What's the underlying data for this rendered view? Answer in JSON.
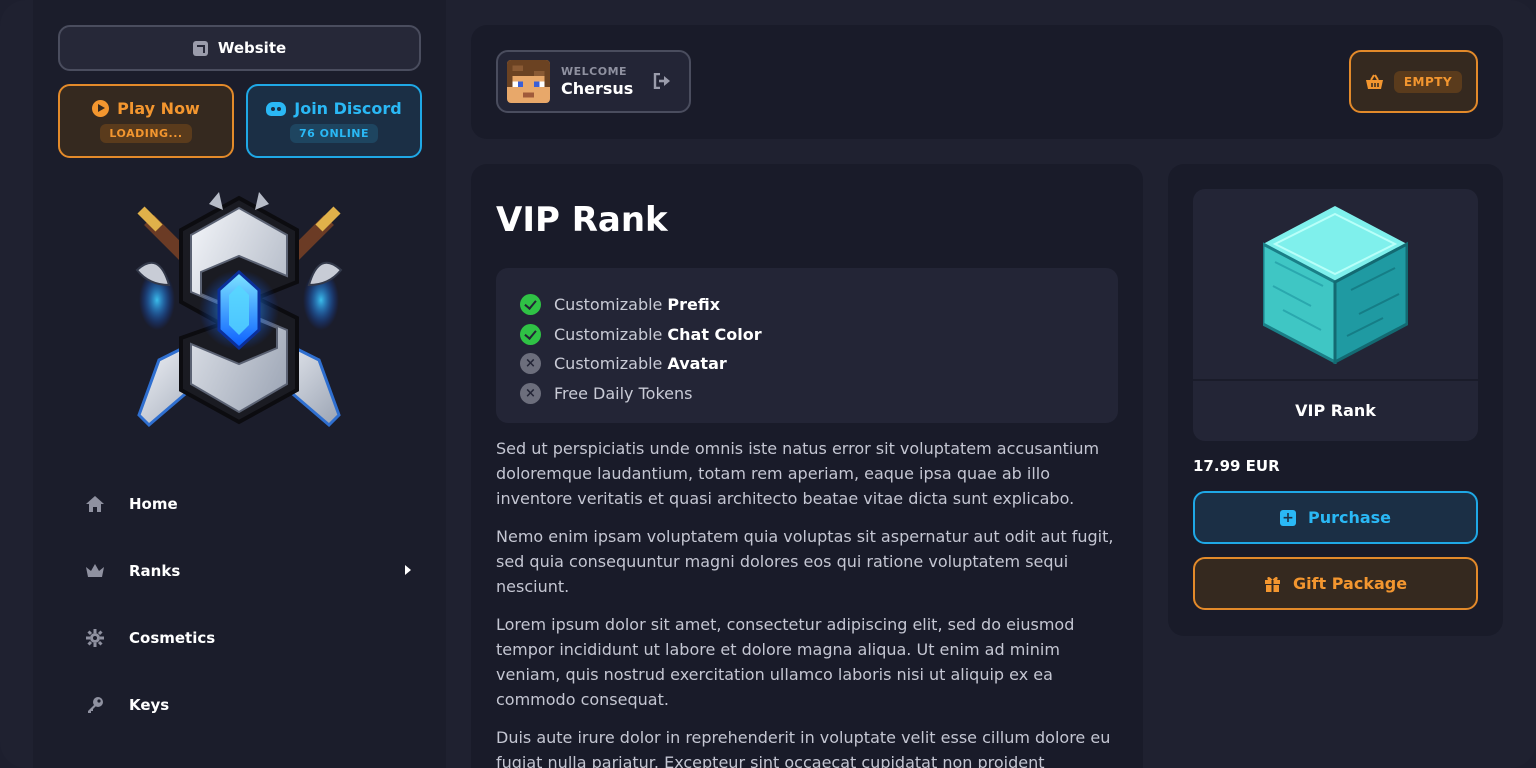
{
  "colors": {
    "accent_orange": "#f3962f",
    "accent_blue": "#2ab8f5",
    "check_green": "#2fc245",
    "background": "#1f2130"
  },
  "sidebar": {
    "website_label": "Website",
    "play": {
      "label": "Play Now",
      "status": "LOADING..."
    },
    "discord": {
      "label": "Join Discord",
      "status": "76 ONLINE"
    },
    "nav": [
      {
        "label": "Home",
        "icon": "home-icon"
      },
      {
        "label": "Ranks",
        "icon": "crown-icon",
        "has_submenu": true
      },
      {
        "label": "Cosmetics",
        "icon": "gear-icon"
      },
      {
        "label": "Keys",
        "icon": "key-icon"
      }
    ]
  },
  "header": {
    "welcome_label": "WELCOME",
    "username": "Chersus",
    "cart_status": "EMPTY"
  },
  "main": {
    "title": "VIP Rank",
    "features": [
      {
        "prefix": "Customizable",
        "bold": "Prefix",
        "included": true
      },
      {
        "prefix": "Customizable",
        "bold": "Chat Color",
        "included": true
      },
      {
        "prefix": "Customizable",
        "bold": "Avatar",
        "included": false
      },
      {
        "prefix": "Free Daily Tokens",
        "bold": "",
        "included": false
      }
    ],
    "paragraphs": [
      "Sed ut perspiciatis unde omnis iste natus error sit voluptatem accusantium doloremque laudantium, totam rem aperiam, eaque ipsa quae ab illo inventore veritatis et quasi architecto beatae vitae dicta sunt explicabo.",
      "Nemo enim ipsam voluptatem quia voluptas sit aspernatur aut odit aut fugit, sed quia consequuntur magni dolores eos qui ratione voluptatem sequi nesciunt.",
      "Lorem ipsum dolor sit amet, consectetur adipiscing elit, sed do eiusmod tempor incididunt ut labore et dolore magna aliqua. Ut enim ad minim veniam, quis nostrud exercitation ullamco laboris nisi ut aliquip ex ea commodo consequat.",
      "Duis aute irure dolor in reprehenderit in voluptate velit esse cillum dolore eu fugiat nulla pariatur. Excepteur sint occaecat cupidatat non proident"
    ]
  },
  "product": {
    "name": "VIP Rank",
    "price": "17.99 EUR",
    "purchase_label": "Purchase",
    "gift_label": "Gift Package"
  }
}
